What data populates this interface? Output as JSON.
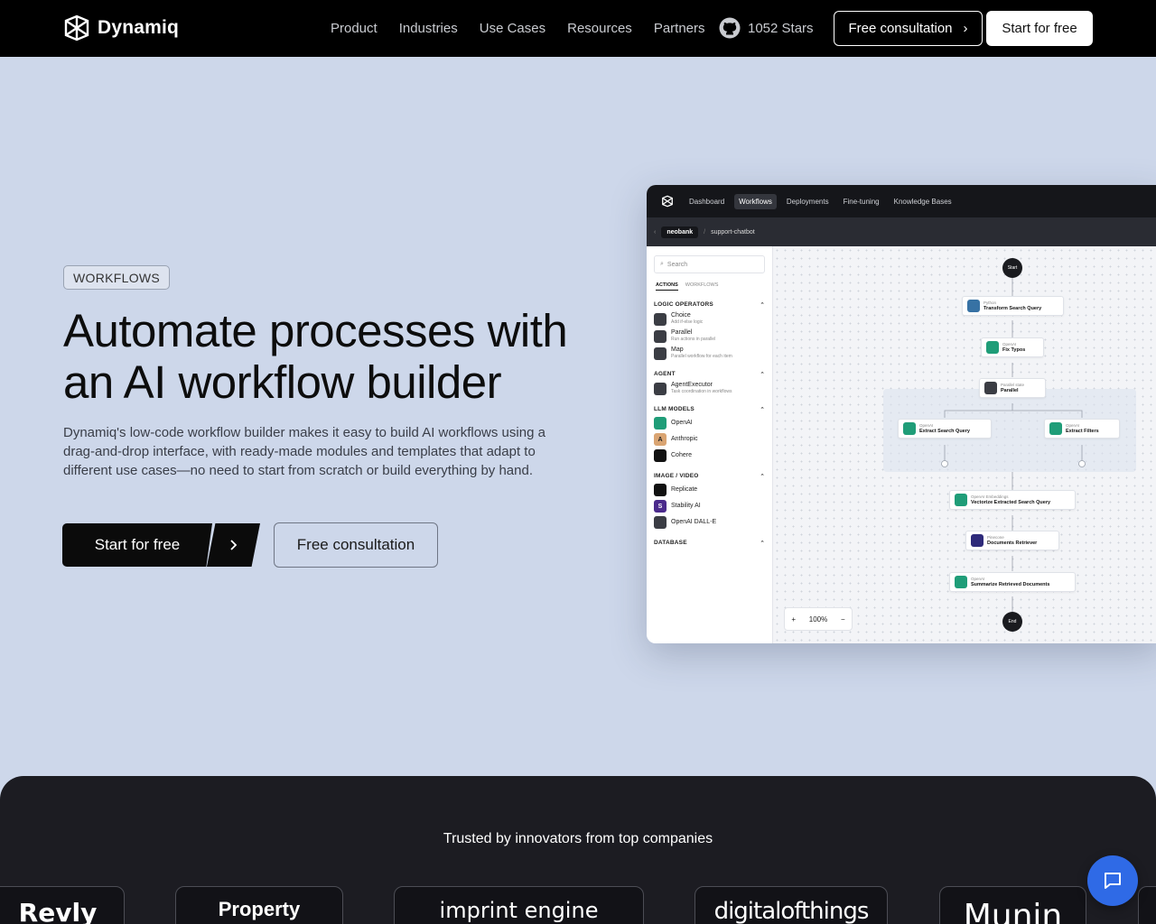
{
  "brand": {
    "name": "Dynamiq"
  },
  "nav": {
    "links": [
      "Product",
      "Industries",
      "Use Cases",
      "Resources",
      "Partners"
    ],
    "github_stars": "1052 Stars",
    "consult_label": "Free consultation",
    "start_label": "Start for free"
  },
  "hero": {
    "badge": "WORKFLOWS",
    "title": "Automate processes with an AI workflow builder",
    "description": "Dynamiq's low-code workflow builder makes it easy to build AI workflows using a drag-and-drop interface, with ready-made modules and templates that adapt to different use cases—no need to start from scratch or build everything by hand.",
    "cta_start": "Start for free",
    "cta_consult": "Free consultation"
  },
  "app": {
    "tabs": [
      "Dashboard",
      "Workflows",
      "Deployments",
      "Fine-tuning",
      "Knowledge Bases"
    ],
    "active_tab": "Workflows",
    "breadcrumb": [
      "neobank",
      "support-chatbot"
    ],
    "search_placeholder": "Search",
    "side_tabs": [
      "ACTIONS",
      "WORKFLOWS"
    ],
    "sections": {
      "logic": "LOGIC OPERATORS",
      "agent": "AGENT",
      "llm": "LLM MODELS",
      "image": "IMAGE / VIDEO",
      "database": "DATABASE"
    },
    "logic_items": [
      {
        "name": "Choice",
        "desc": "Add if-else logic"
      },
      {
        "name": "Parallel",
        "desc": "Run actions in parallel"
      },
      {
        "name": "Map",
        "desc": "Parallel workflow for each item"
      }
    ],
    "agent_items": [
      {
        "name": "AgentExecutor",
        "desc": "Task coordination in workflows"
      }
    ],
    "llm_items": [
      "OpenAI",
      "Anthropic",
      "Cohere"
    ],
    "image_items": [
      "Replicate",
      "Stability AI",
      "OpenAI DALL-E"
    ],
    "zoom": "100%",
    "nodes": {
      "start": "Start",
      "end": "End",
      "n1": {
        "type": "Python",
        "name": "Transform Search Query"
      },
      "n2": {
        "type": "OpenAI",
        "name": "Fix Typos"
      },
      "n3": {
        "type": "Parallel state",
        "name": "Parallel"
      },
      "n4": {
        "type": "OpenAI",
        "name": "Extract Search Query"
      },
      "n5": {
        "type": "OpenAI",
        "name": "Extract Filters"
      },
      "n6": {
        "type": "OpenAI Embeddings",
        "name": "Vectorize Extracted Search Query"
      },
      "n7": {
        "type": "Pinecone",
        "name": "Documents Retriever"
      },
      "n8": {
        "type": "OpenAI",
        "name": "Summarize Retrieved Documents"
      }
    }
  },
  "trusted": {
    "title": "Trusted by innovators from top companies",
    "logos": [
      "Revly",
      "Property",
      "imprint engine",
      "digitalofthings",
      "Munin"
    ]
  }
}
